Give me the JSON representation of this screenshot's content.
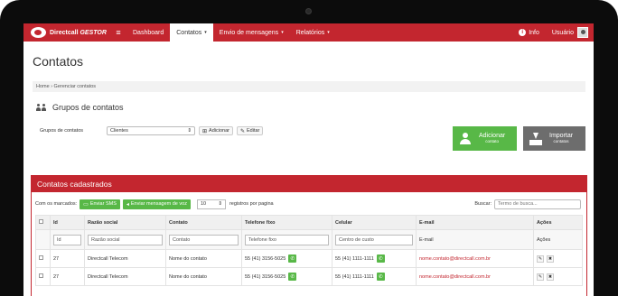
{
  "app": {
    "brand": "Directcall",
    "brand_suffix": "GESTOR"
  },
  "nav": {
    "items": [
      {
        "label": "Dashboard",
        "caret": ""
      },
      {
        "label": "Contatos",
        "caret": "▾"
      },
      {
        "label": "Envio de mensagens",
        "caret": "▾"
      },
      {
        "label": "Relatórios",
        "caret": "▾"
      }
    ],
    "active_index": 1,
    "info_label": "Info",
    "user_label": "Usuário"
  },
  "page": {
    "title": "Contatos",
    "breadcrumb": "Home › Gerenciar contatos"
  },
  "groups": {
    "heading": "Grupos de contatos",
    "label": "Grupos de contatos",
    "selected": "Clientes",
    "add_label": "Adicionar",
    "edit_label": "Editar"
  },
  "actions": {
    "add": {
      "title": "Adicionar",
      "subtitle": "contato"
    },
    "import": {
      "title": "Importar",
      "subtitle": "contatos"
    }
  },
  "contacts": {
    "heading": "Contatos cadastrados",
    "marked_label": "Com os marcados:",
    "send_sms": "Enviar SMS",
    "send_voice": "Enviar mensagem de voz",
    "per_page_value": "10",
    "per_page_label": "registros por pagina",
    "search_label": "Buscar:",
    "search_placeholder": "Termo de busca...",
    "columns": [
      "Id",
      "Razão social",
      "Contato",
      "Telefone fixo",
      "Celular",
      "E-mail",
      "Ações"
    ],
    "filters": {
      "id": "Id",
      "razao": "Razão social",
      "contato": "Contato",
      "telefone": "Telefone fixo",
      "celular": "Centro de custo",
      "email": "E-mail",
      "acoes": "Ações"
    },
    "rows": [
      {
        "id": "27",
        "razao": "Directcall Telecom",
        "contato": "Nome do contato",
        "telefone": "55 (41) 3156-5025",
        "celular": "55 (41) 1111-1111",
        "email": "nome.contato@directcall.com.br"
      },
      {
        "id": "27",
        "razao": "Directcall Telecom",
        "contato": "Nome do contato",
        "telefone": "55 (41) 3156-5025",
        "celular": "55 (41) 1111-1111",
        "email": "nome.contato@directcall.com.br"
      }
    ]
  },
  "colors": {
    "brand_red": "#c3262f",
    "green": "#58b847",
    "gray": "#6d6d6d"
  }
}
